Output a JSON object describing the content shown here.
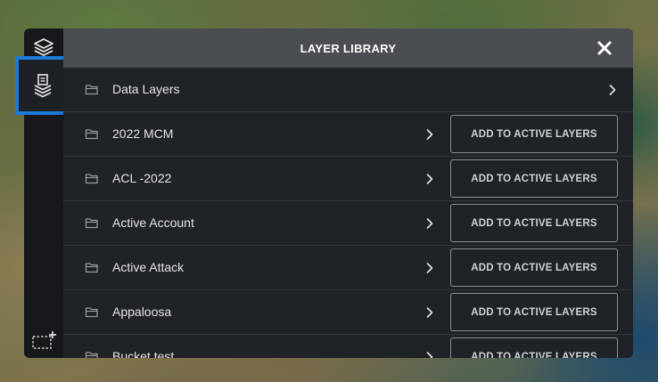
{
  "panel": {
    "title": "LAYER LIBRARY"
  },
  "sidebar": {
    "items": [
      {
        "icon": "layers-icon"
      },
      {
        "icon": "layer-library-icon",
        "active": true
      },
      {
        "icon": "add-area-icon"
      }
    ],
    "active_color": "#1c7ad9"
  },
  "rows": [
    {
      "label": "Data Layers",
      "has_add_button": false
    },
    {
      "label": "2022 MCM",
      "has_add_button": true,
      "button_label": "ADD TO ACTIVE LAYERS"
    },
    {
      "label": "ACL -2022",
      "has_add_button": true,
      "button_label": "ADD TO ACTIVE LAYERS"
    },
    {
      "label": "Active Account",
      "has_add_button": true,
      "button_label": "ADD TO ACTIVE LAYERS"
    },
    {
      "label": "Active Attack",
      "has_add_button": true,
      "button_label": "ADD TO ACTIVE LAYERS"
    },
    {
      "label": "Appaloosa",
      "has_add_button": true,
      "button_label": "ADD TO ACTIVE LAYERS"
    },
    {
      "label": "Bucket test",
      "has_add_button": true,
      "button_label": "ADD TO ACTIVE LAYERS"
    }
  ]
}
